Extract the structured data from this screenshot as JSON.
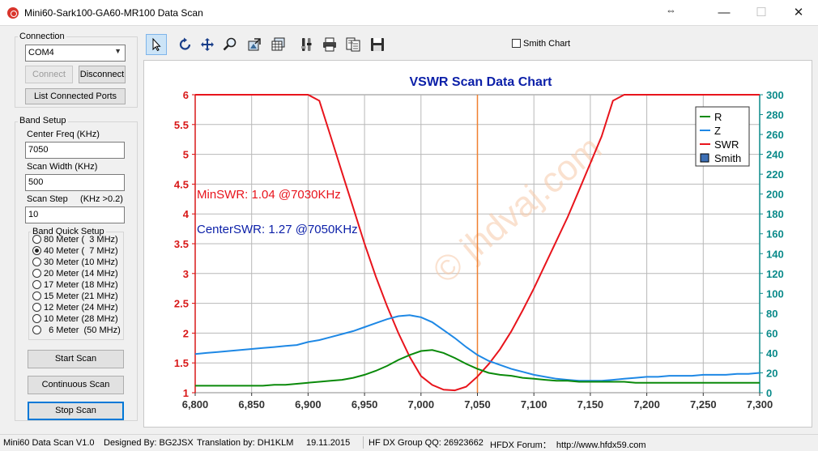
{
  "window": {
    "title": "Mini60-Sark100-GA60-MR100 Data Scan",
    "minimize": "—",
    "maximize": "☐",
    "close": "✕",
    "resize_glyph": "⇔"
  },
  "connection": {
    "group_label": "Connection",
    "port_value": "COM4",
    "connect_label": "Connect",
    "disconnect_label": "Disconnect",
    "list_ports_label": "List Connected Ports"
  },
  "band_setup": {
    "group_label": "Band Setup",
    "center_freq_label": "Center Freq  (KHz)",
    "center_freq_value": "7050",
    "scan_width_label": "Scan Width   (KHz)",
    "scan_width_value": "500",
    "scan_step_label": "Scan Step     (KHz >0.2)",
    "scan_step_value": "10",
    "quick_setup_label": "Band Quick Setup",
    "bands": [
      {
        "label": "80 Meter (  3 MHz)",
        "selected": false
      },
      {
        "label": "40 Meter (  7 MHz)",
        "selected": true
      },
      {
        "label": "30 Meter (10 MHz)",
        "selected": false
      },
      {
        "label": "20 Meter (14 MHz)",
        "selected": false
      },
      {
        "label": "17 Meter (18 MHz)",
        "selected": false
      },
      {
        "label": "15 Meter (21 MHz)",
        "selected": false
      },
      {
        "label": "12 Meter (24 MHz)",
        "selected": false
      },
      {
        "label": "10 Meter (28 MHz)",
        "selected": false
      },
      {
        "label": "  6 Meter  (50 MHz)",
        "selected": false
      }
    ],
    "start_scan_label": "Start Scan",
    "continuous_scan_label": "Continuous Scan",
    "stop_scan_label": "Stop Scan"
  },
  "toolbar": {
    "tools": [
      "pointer-icon",
      "rotate-icon",
      "pan-icon",
      "zoom-icon",
      "export-image-icon",
      "data-grid-icon",
      "settings-tools-icon",
      "print-icon",
      "print-preview-icon",
      "save-icon"
    ],
    "smith_chart_label": "Smith Chart"
  },
  "status": {
    "version": "Mini60 Data Scan V1.0",
    "designed_by": "Designed By: BG2JSX",
    "translation": "Translation by: DH1KLM",
    "date": "19.11.2015",
    "group": "HF DX Group QQ: 26923662",
    "forum": "HFDX Forum：  http://www.hfdx59.com"
  },
  "chart_data": {
    "type": "line",
    "title": "VSWR Scan Data Chart",
    "watermark": "© jhdvaj.com",
    "x_ticks": [
      "6,800",
      "6,850",
      "6,900",
      "6,950",
      "7,000",
      "7,050",
      "7,100",
      "7,150",
      "7,200",
      "7,250",
      "7,300"
    ],
    "xlim": [
      6800,
      7300
    ],
    "y_left_ticks": [
      "1",
      "1.5",
      "2",
      "2.5",
      "3",
      "3.5",
      "4",
      "4.5",
      "5",
      "5.5",
      "6"
    ],
    "ylim_left": [
      1,
      6
    ],
    "y_right_ticks": [
      "0",
      "20",
      "40",
      "60",
      "80",
      "100",
      "120",
      "140",
      "160",
      "180",
      "200",
      "220",
      "240",
      "260",
      "280",
      "300"
    ],
    "ylim_right": [
      0,
      300
    ],
    "center_marker_x": 7050,
    "annotations": [
      "MinSWR: 1.04 @7030KHz",
      "CenterSWR: 1.27 @7050KHz"
    ],
    "legend": [
      "R",
      "Z",
      "SWR",
      "Smith"
    ],
    "legend_position": "top-right",
    "grid": true,
    "colors": {
      "R": "#0a8a0a",
      "Z": "#1e88e5",
      "SWR": "#e8141c",
      "center": "#f08030",
      "right_axis": "#0a8a8a",
      "title": "#0b1fa8"
    },
    "x": [
      6800,
      6810,
      6820,
      6830,
      6840,
      6850,
      6860,
      6870,
      6880,
      6890,
      6900,
      6910,
      6920,
      6930,
      6940,
      6950,
      6960,
      6970,
      6980,
      6990,
      7000,
      7010,
      7020,
      7030,
      7040,
      7050,
      7060,
      7070,
      7080,
      7090,
      7100,
      7110,
      7120,
      7130,
      7140,
      7150,
      7160,
      7170,
      7180,
      7190,
      7200,
      7210,
      7220,
      7230,
      7240,
      7250,
      7260,
      7270,
      7280,
      7290,
      7300
    ],
    "series": [
      {
        "name": "SWR",
        "axis": "left",
        "values": [
          6,
          6,
          6,
          6,
          6,
          6,
          6,
          6,
          6,
          6,
          6,
          5.9,
          5.3,
          4.7,
          4.1,
          3.5,
          2.95,
          2.45,
          2.0,
          1.6,
          1.28,
          1.13,
          1.05,
          1.04,
          1.1,
          1.27,
          1.48,
          1.73,
          2.03,
          2.38,
          2.75,
          3.15,
          3.55,
          3.95,
          4.4,
          4.85,
          5.3,
          5.9,
          6,
          6,
          6,
          6,
          6,
          6,
          6,
          6,
          6,
          6,
          6,
          6,
          6
        ]
      },
      {
        "name": "Z",
        "axis": "right",
        "values": [
          39,
          40,
          41,
          42,
          43,
          44,
          45,
          46,
          47,
          48,
          51,
          53,
          56,
          59,
          62,
          66,
          70,
          74,
          77,
          78,
          76,
          71,
          63,
          55,
          46,
          38,
          32,
          28,
          24,
          21,
          18,
          16,
          14,
          13,
          12,
          12,
          12,
          13,
          14,
          15,
          16,
          16,
          17,
          17,
          17,
          18,
          18,
          18,
          19,
          19,
          20
        ]
      },
      {
        "name": "R",
        "axis": "right",
        "values": [
          7,
          7,
          7,
          7,
          7,
          7,
          7,
          8,
          8,
          9,
          10,
          11,
          12,
          13,
          15,
          18,
          22,
          27,
          33,
          38,
          42,
          43,
          40,
          35,
          29,
          24,
          20,
          18,
          17,
          15,
          14,
          13,
          12,
          12,
          11,
          11,
          11,
          11,
          11,
          10,
          10,
          10,
          10,
          10,
          10,
          10,
          10,
          10,
          10,
          10,
          10
        ]
      }
    ]
  }
}
